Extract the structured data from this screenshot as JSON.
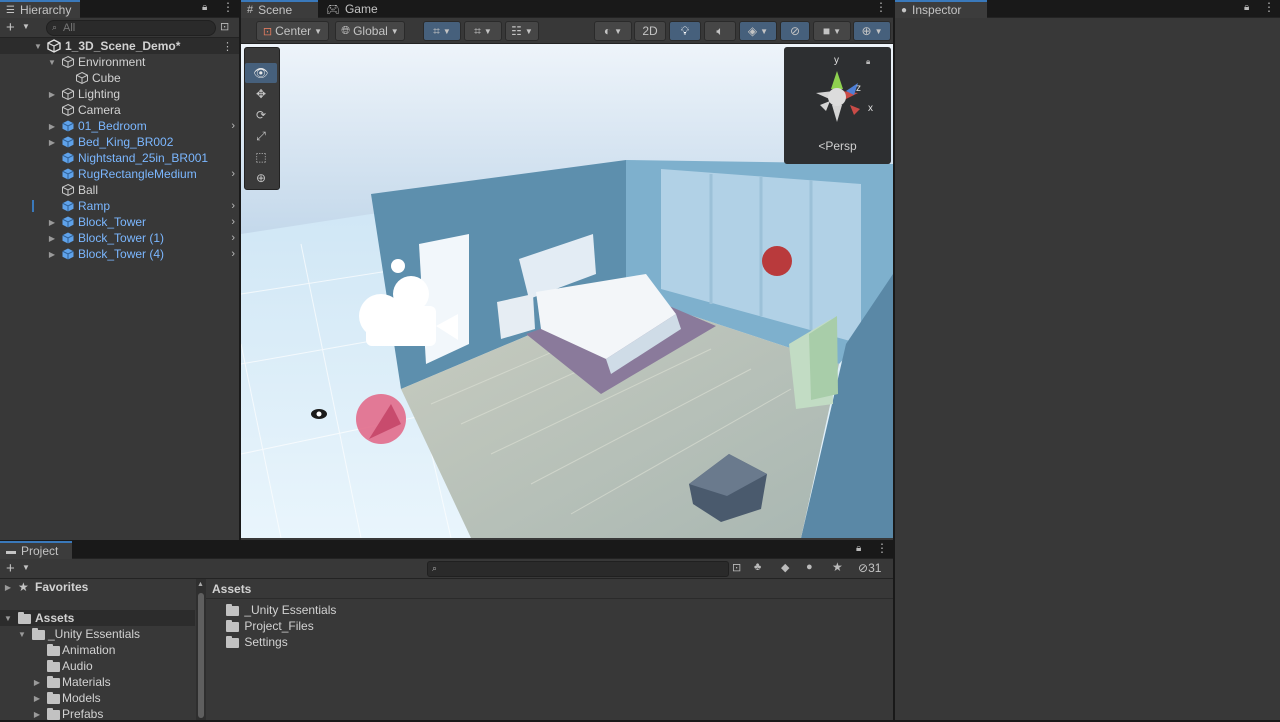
{
  "hierarchy": {
    "title": "Hierarchy",
    "search_placeholder": "All",
    "add_label": "+",
    "items": [
      {
        "label": "1_3D_Scene_Demo*",
        "type": "scene"
      },
      {
        "label": "Environment",
        "type": "object"
      },
      {
        "label": "Cube",
        "type": "object"
      },
      {
        "label": "Lighting",
        "type": "object"
      },
      {
        "label": "Camera",
        "type": "object"
      },
      {
        "label": "01_Bedroom",
        "type": "prefab"
      },
      {
        "label": "Bed_King_BR002",
        "type": "prefab"
      },
      {
        "label": "Nightstand_25in_BR001",
        "type": "prefab"
      },
      {
        "label": "RugRectangleMedium",
        "type": "prefab"
      },
      {
        "label": "Ball",
        "type": "object"
      },
      {
        "label": "Ramp",
        "type": "prefab"
      },
      {
        "label": "Block_Tower",
        "type": "prefab"
      },
      {
        "label": "Block_Tower (1)",
        "type": "prefab"
      },
      {
        "label": "Block_Tower (4)",
        "type": "prefab"
      }
    ]
  },
  "scene_tabs": {
    "scene": "Scene",
    "game": "Game"
  },
  "scene_toolbar": {
    "pivot": "Center",
    "space": "Global",
    "mode_2d": "2D"
  },
  "gizmo": {
    "persp": "Persp",
    "x": "x",
    "y": "y",
    "z": "z"
  },
  "inspector": {
    "title": "Inspector"
  },
  "project": {
    "title": "Project",
    "hidden_count": "31",
    "favorites": "Favorites",
    "assets_root": "Assets",
    "tree": [
      "_Unity Essentials",
      "Animation",
      "Audio",
      "Materials",
      "Models",
      "Prefabs"
    ],
    "breadcrumb": "Assets",
    "folders": [
      "_Unity Essentials",
      "Project_Files",
      "Settings"
    ]
  },
  "colors": {
    "accent": "#3a79bb",
    "prefab_text": "#7bb7ff",
    "panel": "#383838"
  }
}
